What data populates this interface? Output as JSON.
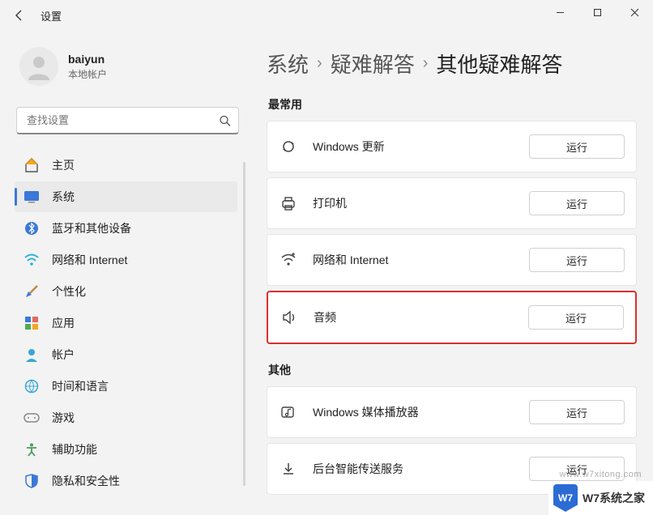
{
  "window": {
    "title": "设置"
  },
  "user": {
    "name": "baiyun",
    "sub": "本地帐户"
  },
  "search": {
    "placeholder": "查找设置"
  },
  "sidebar": {
    "items": [
      {
        "label": "主页"
      },
      {
        "label": "系统"
      },
      {
        "label": "蓝牙和其他设备"
      },
      {
        "label": "网络和 Internet"
      },
      {
        "label": "个性化"
      },
      {
        "label": "应用"
      },
      {
        "label": "帐户"
      },
      {
        "label": "时间和语言"
      },
      {
        "label": "游戏"
      },
      {
        "label": "辅助功能"
      },
      {
        "label": "隐私和安全性"
      }
    ]
  },
  "breadcrumbs": {
    "a": "系统",
    "b": "疑难解答",
    "c": "其他疑难解答"
  },
  "sections": {
    "mostUsed": {
      "title": "最常用"
    },
    "other": {
      "title": "其他"
    }
  },
  "cards": {
    "update": {
      "label": "Windows 更新",
      "run": "运行"
    },
    "printer": {
      "label": "打印机",
      "run": "运行"
    },
    "network": {
      "label": "网络和 Internet",
      "run": "运行"
    },
    "audio": {
      "label": "音频",
      "run": "运行"
    },
    "media": {
      "label": "Windows 媒体播放器",
      "run": "运行"
    },
    "bits": {
      "label": "后台智能传送服务",
      "run": "运行"
    }
  },
  "watermark": "www.w7xitong.com",
  "footerLogo": {
    "badge": "W7",
    "text": "W7系统之家"
  }
}
